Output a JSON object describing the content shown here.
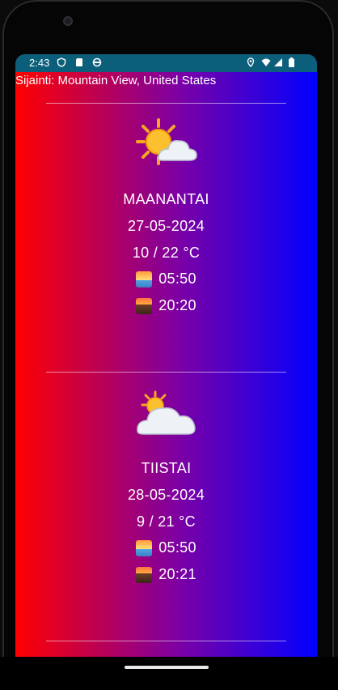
{
  "status_bar": {
    "time": "2:43",
    "icons": [
      "shield-icon",
      "sd-card-icon",
      "sync-icon",
      "location-icon",
      "wifi-icon",
      "signal-icon",
      "battery-icon"
    ]
  },
  "location": {
    "label": "Sijainti: Mountain View, United States"
  },
  "days": [
    {
      "weather_icon": "sun-behind-cloud-icon",
      "name": "MAANANTAI",
      "date": "27-05-2024",
      "temp": "10 / 22 °C",
      "sunrise": "05:50",
      "sunset": "20:20"
    },
    {
      "weather_icon": "sun-behind-large-cloud-icon",
      "name": "TIISTAI",
      "date": "28-05-2024",
      "temp": "9 / 21 °C",
      "sunrise": "05:50",
      "sunset": "20:21"
    }
  ],
  "colors": {
    "gradient_start": "#ff0000",
    "gradient_end": "#0000ff",
    "status_bar": "#0b5f7a"
  }
}
